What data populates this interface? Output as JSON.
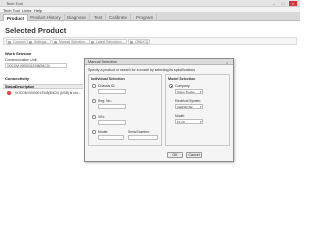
{
  "window": {
    "title": "Tech Tool",
    "controls": {
      "minimize": "–",
      "maximize": "□",
      "close": "×"
    }
  },
  "menu": [
    "Tech Tool",
    "Links",
    "Help"
  ],
  "tabs": [
    "Product",
    "Product History",
    "Diagnose",
    "Test",
    "Calibrate",
    "Program"
  ],
  "page": {
    "title": "Selected Product"
  },
  "toolbar": {
    "buttons": [
      "Connect",
      "Settings...",
      "Manual Selection...",
      "Latest Selections...",
      "OBD/CQ"
    ]
  },
  "work_session": {
    "title": "Work Session",
    "comm_unit_label": "Communication Unit:",
    "comm_unit_value": "VOCOM II0000012345(B4C0)"
  },
  "connectivity": {
    "title": "Connectivity",
    "headers": {
      "status": "Status",
      "description": "Description"
    },
    "rows": [
      {
        "status_icon": "!",
        "description": "VOCOM II0000012345(B4C0) (USB) is not..."
      }
    ]
  },
  "dialog": {
    "title": "Manual Selection",
    "close": "×",
    "instructions": "Specify a product or search for a model by selecting its specifications",
    "individual": {
      "title": "Individual Selection",
      "options": [
        "Chassis ID:",
        "Reg. No.:",
        "VIN:",
        "Model:"
      ],
      "serial_label": "Serial Number:"
    },
    "model": {
      "title": "Model Selection",
      "company_label": "Company:",
      "company_value": "Volvo Trucks",
      "electrical_label": "Electrical System:",
      "electrical_value": "VERSION2",
      "model_label": "Model:",
      "model_value": "FL (2)"
    },
    "buttons": {
      "ok": "OK",
      "cancel": "Cancel"
    }
  },
  "colors": {
    "close_button": "#d9363e",
    "error_status": "#dd3333"
  }
}
